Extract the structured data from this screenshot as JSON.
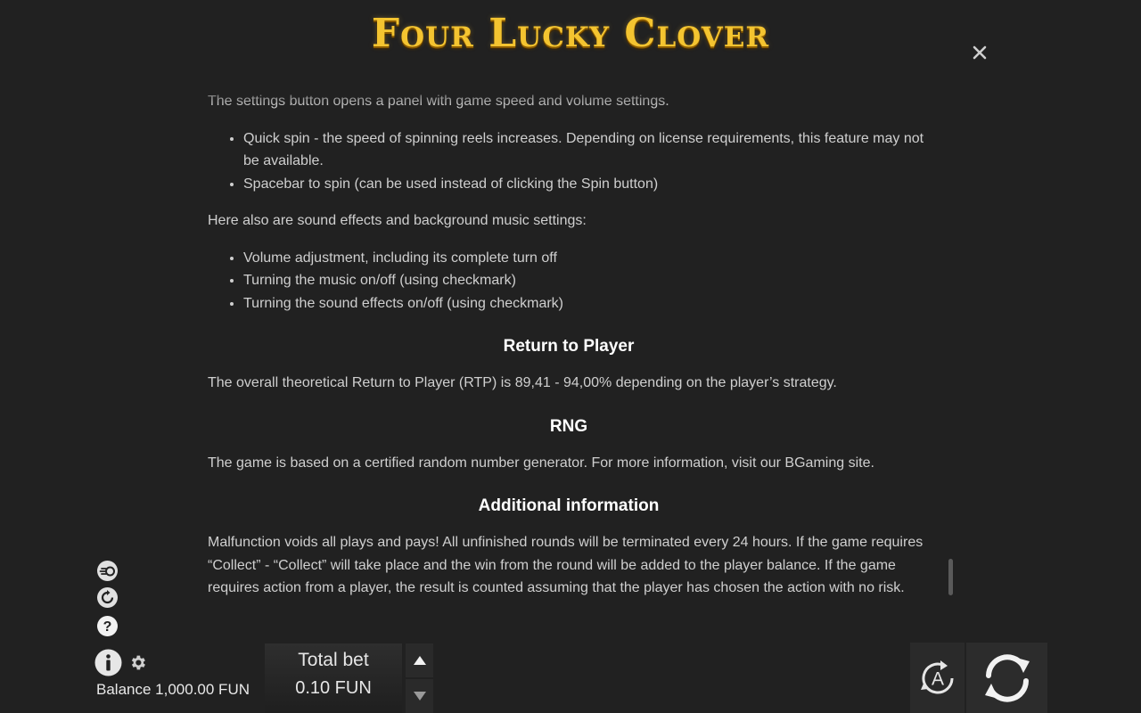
{
  "header": {
    "logo_text": "Four Lucky Clover",
    "close_icon": "close-icon"
  },
  "rules": {
    "settings_intro": "The settings button opens a panel with game speed and volume settings.",
    "settings_items": [
      "Quick spin - the speed of spinning reels increases. Depending on license requirements, this feature may not be available.",
      "Spacebar to spin (can be used instead of clicking the Spin button)"
    ],
    "sound_intro": "Here also are sound effects and background music settings:",
    "sound_items": [
      "Volume adjustment, including its complete turn off",
      "Turning the music on/off (using checkmark)",
      "Turning the sound effects on/off (using checkmark)"
    ],
    "rtp_heading": "Return to Player",
    "rtp_text": "The overall theoretical Return to Player (RTP) is 89,41 - 94,00% depending on the player’s strategy.",
    "rng_heading": "RNG",
    "rng_text": "The game is based on a certified random number generator. For more information, visit our BGaming site.",
    "additional_heading": "Additional information",
    "additional_text": "Malfunction voids all plays and pays! All unfinished rounds will be terminated every 24 hours. If the game requires “Collect” - “Collect” will take place and the win from the round will be added to the player balance. If the game requires action from a player, the result is counted assuming that the player has chosen the action with no risk."
  },
  "side_icons": [
    "turbo-icon",
    "autospin-icon",
    "help-icon"
  ],
  "footer": {
    "info_icon": "info-icon",
    "settings_icon": "gear-icon",
    "balance_text": "Balance 1,000.00 FUN",
    "bet_label": "Total bet",
    "bet_value": "0.10 FUN",
    "bet_up_icon": "triangle-up-icon",
    "bet_down_icon": "triangle-down-icon",
    "autoplay_letter": "A",
    "autoplay_icon": "autoplay-icon",
    "spin_icon": "spin-icon"
  },
  "colors": {
    "background": "#212121",
    "text": "#cfcfcf",
    "heading": "#ffffff",
    "logo_gold": "#f4c430"
  }
}
